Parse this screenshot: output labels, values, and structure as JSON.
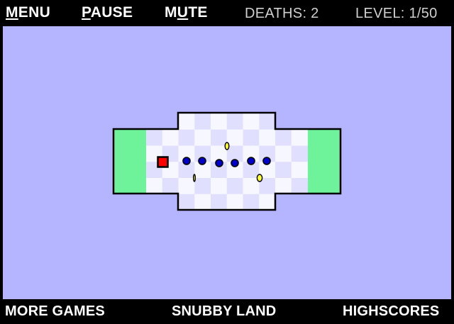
{
  "header": {
    "menu": {
      "hotkey": "M",
      "rest": "ENU"
    },
    "pause": {
      "hotkey": "P",
      "rest": "AUSE"
    },
    "mute": {
      "pre": "M",
      "hotkey": "U",
      "rest": "TE"
    },
    "deaths": "DEATHS: 2",
    "level": "LEVEL: 1/50"
  },
  "footer": {
    "more_games": "MORE GAMES",
    "sponsor": "SNUBBY LAND",
    "highscores": "HIGHSCORES"
  },
  "colors": {
    "background": "#b4b4ff",
    "safe_zone": "#6ef29a",
    "tile_light": "#f7f7ff",
    "tile_dark": "#e0e0fe",
    "player": "#ff0000",
    "enemy": "#0000cc",
    "coin": "#ffff33",
    "wall": "#000000"
  },
  "game": {
    "player_count": 1,
    "enemy_count": 6,
    "coin_count": 3
  }
}
